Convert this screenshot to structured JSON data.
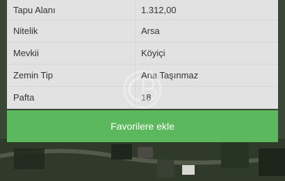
{
  "details": {
    "rows": [
      {
        "label": "Tapu Alanı",
        "value": "1.312,00"
      },
      {
        "label": "Nitelik",
        "value": "Arsa"
      },
      {
        "label": "Mevkii",
        "value": "Köyiçi"
      },
      {
        "label": "Zemin Tip",
        "value": "Ana Taşınmaz"
      },
      {
        "label": "Pafta",
        "value": "18"
      }
    ]
  },
  "actions": {
    "favorite_label": "Favorilere ekle"
  },
  "colors": {
    "button_green": "#5cb85c"
  },
  "watermark": {
    "icon": "cb-logo-icon"
  }
}
